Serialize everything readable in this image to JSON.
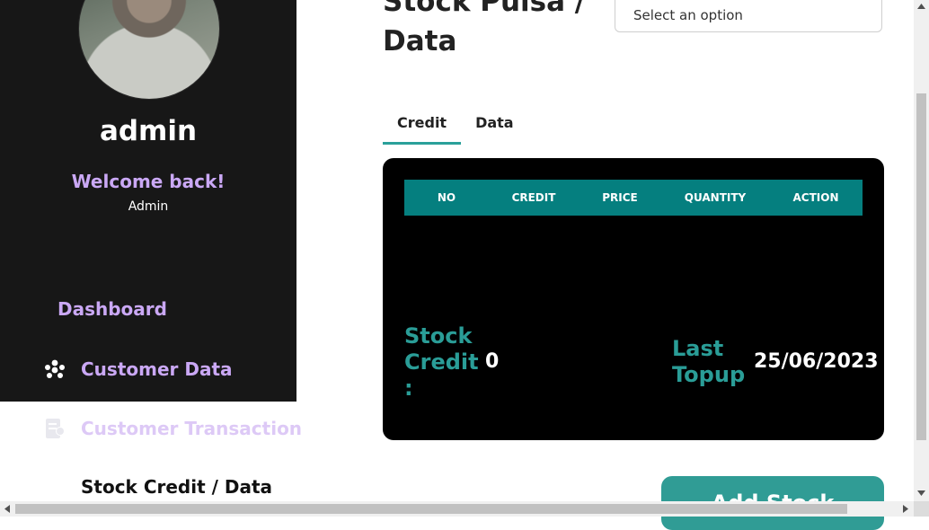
{
  "sidebar": {
    "user_name": "admin",
    "welcome": "Welcome back!",
    "role": "Admin",
    "nav": {
      "dashboard": "Dashboard",
      "customer_data": "Customer Data",
      "customer_transaction": "Customer Transaction",
      "stock": "Stock Credit / Data"
    },
    "icons": [
      "people-icon",
      "receipt-icon"
    ]
  },
  "main": {
    "title": "Stock Pulsa / Data",
    "select_placeholder": "Select an option",
    "tabs": [
      {
        "label": "Credit",
        "active": true
      },
      {
        "label": "Data",
        "active": false
      }
    ],
    "table": {
      "headers": [
        "NO",
        "CREDIT",
        "PRICE",
        "QUANTITY",
        "ACTION"
      ],
      "rows": []
    },
    "stock_credit_label": "Stock Credit :",
    "stock_credit_value": "0",
    "last_topup_label": "Last Topup",
    "last_topup_value": "25/06/2023",
    "add_button": "Add Stock"
  },
  "colors": {
    "sidebar_bg": "#171717",
    "accent_purple": "#caa8f5",
    "teal_header": "#057f7f",
    "teal_text": "#2a9d97",
    "button": "#309c95"
  }
}
